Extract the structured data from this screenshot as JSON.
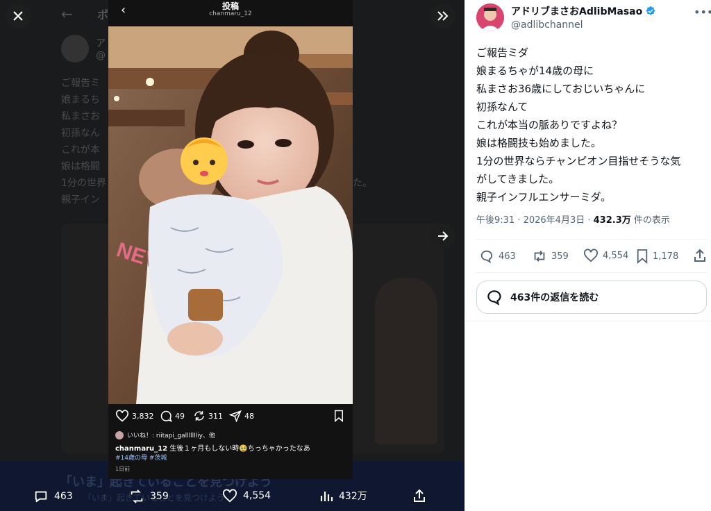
{
  "viewer": {
    "background_tweet": {
      "header": "ポ",
      "name_snippet": "ア",
      "handle_snippet": "@",
      "lines": [
        "ご報告ミ",
        "娘まるち",
        "私まさお",
        "初孫なん",
        "これが本",
        "娘は格闘",
        "1分の世界",
        "親子イン"
      ],
      "line7_tail": "た。",
      "banner_title": "「いま」起きていることを見つけよう",
      "banner_sub": "「いま」起きていることを見つけよう"
    },
    "instagram": {
      "title": "投稿",
      "username": "chanmaru_12",
      "likes": "3,832",
      "comments": "49",
      "reposts": "311",
      "shares": "48",
      "liked_by": "いいね！: riitapi_gallllllliy、他",
      "caption_user": "chanmaru_12",
      "caption_text": "生後１ヶ月もしない時🥹ちっちゃかったなあ",
      "hashtags": "#14歳の母 #茨城",
      "time": "1日前"
    },
    "bottom_bar": {
      "replies": "463",
      "reposts": "359",
      "likes": "4,554",
      "views": "432万"
    }
  },
  "tweet": {
    "author_name": "アドリブまさおAdlibMasao",
    "handle": "@adlibchannel",
    "lines": [
      "ご報告ミダ",
      "娘まるちゃが14歳の母に",
      "私まさお36歳にしておじいちゃんに",
      "初孫なんて",
      "これが本当の脈ありですよね？",
      "娘は格闘技も始めました。",
      "1分の世界ならチャンピオン目指せそうな気",
      "がしてきました。",
      "親子インフルエンサーミダ。"
    ],
    "time": "午後9:31 · 2026年4月3日 · ",
    "views_count": "432.3万",
    "views_label": " 件の表示",
    "replies": "463",
    "reposts": "359",
    "likes": "4,554",
    "bookmarks": "1,178",
    "read_replies": "463件の返信を読む"
  },
  "colors": {
    "verified": "#1d9bf0",
    "text_primary": "#0f1419",
    "text_secondary": "#536471",
    "hashtag": "#9ac3ff"
  },
  "icons": [
    "close-icon",
    "expand-icon",
    "arrow-right-icon",
    "chevron-left-icon",
    "heart-icon",
    "comment-icon",
    "repost-icon",
    "share-icon",
    "bookmark-icon",
    "mute-icon",
    "views-icon",
    "upload-icon",
    "verified-icon",
    "more-icon"
  ]
}
